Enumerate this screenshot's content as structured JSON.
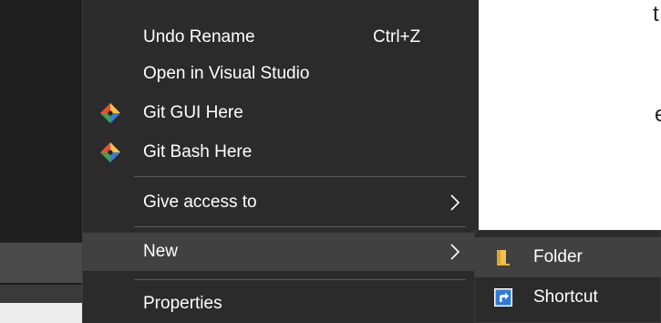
{
  "context_menu": {
    "items": [
      {
        "label": "Undo Rename",
        "shortcut": "Ctrl+Z"
      },
      {
        "label": "Open in Visual Studio"
      },
      {
        "label": "Git GUI Here",
        "icon": "git-icon"
      },
      {
        "label": "Git Bash Here",
        "icon": "git-icon"
      },
      {
        "label": "Give access to",
        "submenu": true
      },
      {
        "label": "New",
        "submenu": true,
        "highlighted": true
      },
      {
        "label": "Properties"
      }
    ]
  },
  "new_submenu": {
    "items": [
      {
        "label": "Folder",
        "icon": "folder-icon",
        "highlighted": true
      },
      {
        "label": "Shortcut",
        "icon": "shortcut-icon"
      }
    ]
  },
  "background": {
    "chars": [
      "t",
      "e"
    ]
  },
  "colors": {
    "menu_bg": "#2b2b2b",
    "hover_bg": "#414141",
    "text": "#ffffff",
    "folder": "#f2c14e",
    "shortcut": "#2f7bd6"
  }
}
